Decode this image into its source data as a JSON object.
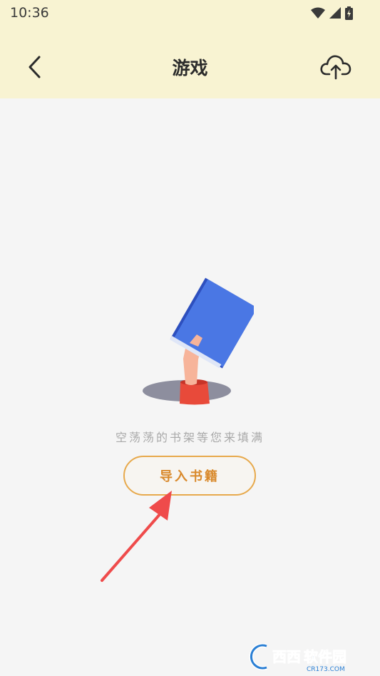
{
  "status_bar": {
    "time": "10:36",
    "icons": [
      "wifi-icon",
      "signal-icon",
      "battery-charging-icon"
    ]
  },
  "header": {
    "title": "游戏",
    "left_icon": "back-chevron-icon",
    "right_icon": "cloud-upload-icon"
  },
  "empty_state": {
    "message": "空荡荡的书架等您来填满",
    "button_label": "导入书籍"
  },
  "watermark": {
    "text": "西西软件园",
    "subtext": "CR173.COM"
  },
  "colors": {
    "header_bg": "#f8f3d2",
    "page_bg": "#f5f5f5",
    "accent": "#e7a94c",
    "book_blue": "#4a77e4",
    "arrow_red": "#ef4b4b"
  }
}
